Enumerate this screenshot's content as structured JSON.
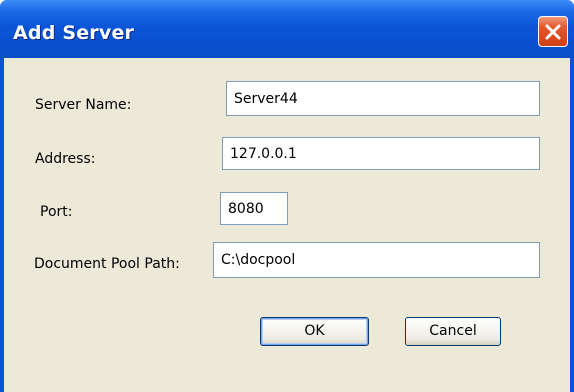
{
  "window": {
    "title": "Add Server",
    "close_icon": "close-icon"
  },
  "form": {
    "server_name": {
      "label": "Server Name:",
      "value": "Server44"
    },
    "address": {
      "label": "Address:",
      "value": "127.0.0.1"
    },
    "port": {
      "label": "Port:",
      "value": "8080"
    },
    "document_pool_path": {
      "label": "Document Pool Path:",
      "value": "C:\\docpool"
    }
  },
  "buttons": {
    "ok_label": "OK",
    "cancel_label": "Cancel"
  },
  "colors": {
    "titlebar": "#0a52d6",
    "dialog_background": "#ece9d8",
    "close_button": "#d13f14",
    "field_border": "#7f9db9"
  }
}
